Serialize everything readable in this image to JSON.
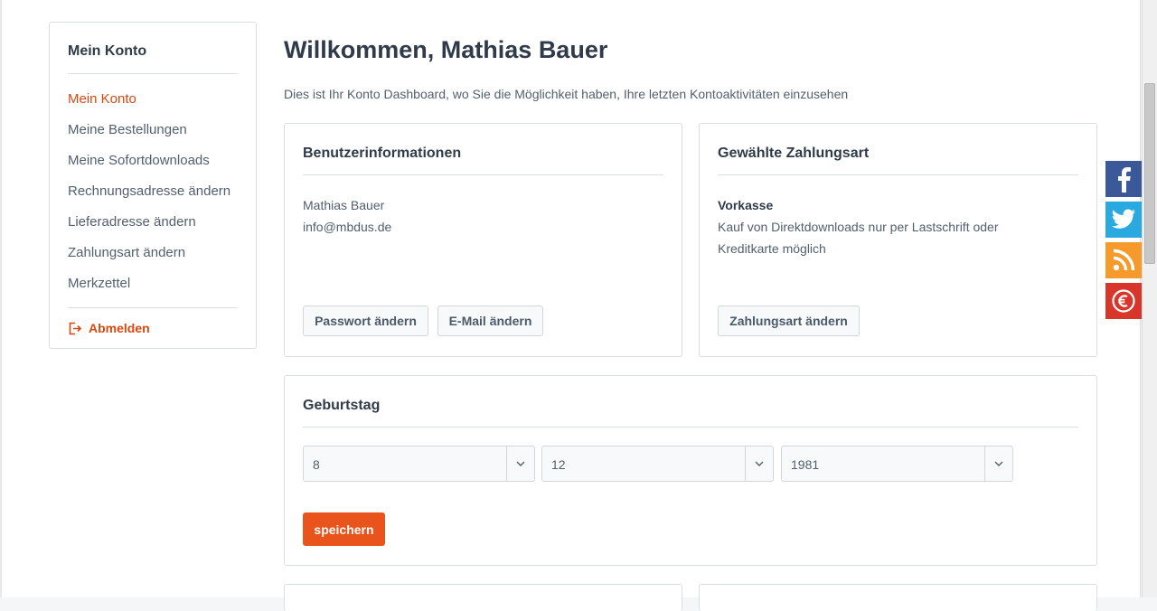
{
  "sidebar": {
    "title": "Mein Konto",
    "items": [
      {
        "label": "Mein Konto",
        "active": true
      },
      {
        "label": "Meine Bestellungen"
      },
      {
        "label": "Meine Sofortdownloads"
      },
      {
        "label": "Rechnungsadresse ändern"
      },
      {
        "label": "Lieferadresse ändern"
      },
      {
        "label": "Zahlungsart ändern"
      },
      {
        "label": "Merkzettel"
      }
    ],
    "logout_label": "Abmelden"
  },
  "main": {
    "welcome": "Willkommen, Mathias Bauer",
    "intro": "Dies ist Ihr Konto Dashboard, wo Sie die Möglichkeit haben, Ihre letzten Kontoaktivitäten einzusehen"
  },
  "user_panel": {
    "title": "Benutzerinformationen",
    "name": "Mathias Bauer",
    "email": "info@mbdus.de",
    "password_button": "Passwort ändern",
    "email_button": "E-Mail ändern"
  },
  "payment_panel": {
    "title": "Gewählte Zahlungsart",
    "method": "Vorkasse",
    "note_line1": "Kauf von Direktdownloads nur per Lastschrift oder",
    "note_line2": "Kreditkarte möglich",
    "change_button": "Zahlungsart ändern"
  },
  "birthday_panel": {
    "title": "Geburtstag",
    "day": "8",
    "month": "12",
    "year": "1981",
    "save_button": "speichern"
  },
  "social": {
    "facebook_color": "#3b5998",
    "twitter_color": "#2aa9e0",
    "rss_color": "#f59a2b",
    "euro_color": "#d8362a"
  },
  "colors": {
    "accent": "#e8541b",
    "active_link": "#d9480f",
    "heading": "#2f3b4a",
    "text": "#52606d",
    "border": "#dadde1"
  }
}
